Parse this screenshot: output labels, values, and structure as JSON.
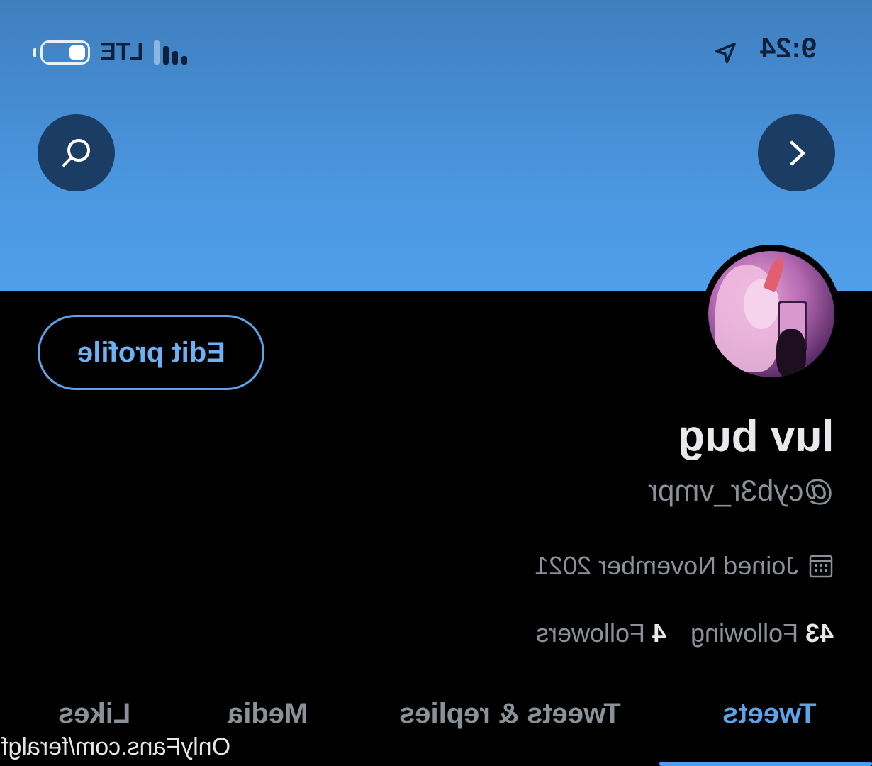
{
  "status_bar": {
    "time": "9:24",
    "network": "LTE",
    "signal_bars": 4,
    "battery_level": 0.3
  },
  "header": {
    "banner_color": "#4a95de",
    "nav_buttons": [
      {
        "name": "search-icon"
      },
      {
        "name": "chevron-icon"
      }
    ]
  },
  "profile": {
    "edit_label": "Edit profile",
    "display_name": "luv bug",
    "handle": "@cyb3r_vmpr",
    "joined": "Joined November 2021",
    "following_count": "43",
    "following_label": "Following",
    "followers_count": "4",
    "followers_label": "Followers"
  },
  "tabs": [
    {
      "label": "Tweets",
      "active": true
    },
    {
      "label": "Tweets & replies",
      "active": false
    },
    {
      "label": "Media",
      "active": false
    },
    {
      "label": "Likes",
      "active": false
    }
  ],
  "watermark": "OnlyFans.com/feralgf",
  "colors": {
    "accent": "#5fa3e6",
    "background": "#000000",
    "muted_text": "#8b9198"
  }
}
